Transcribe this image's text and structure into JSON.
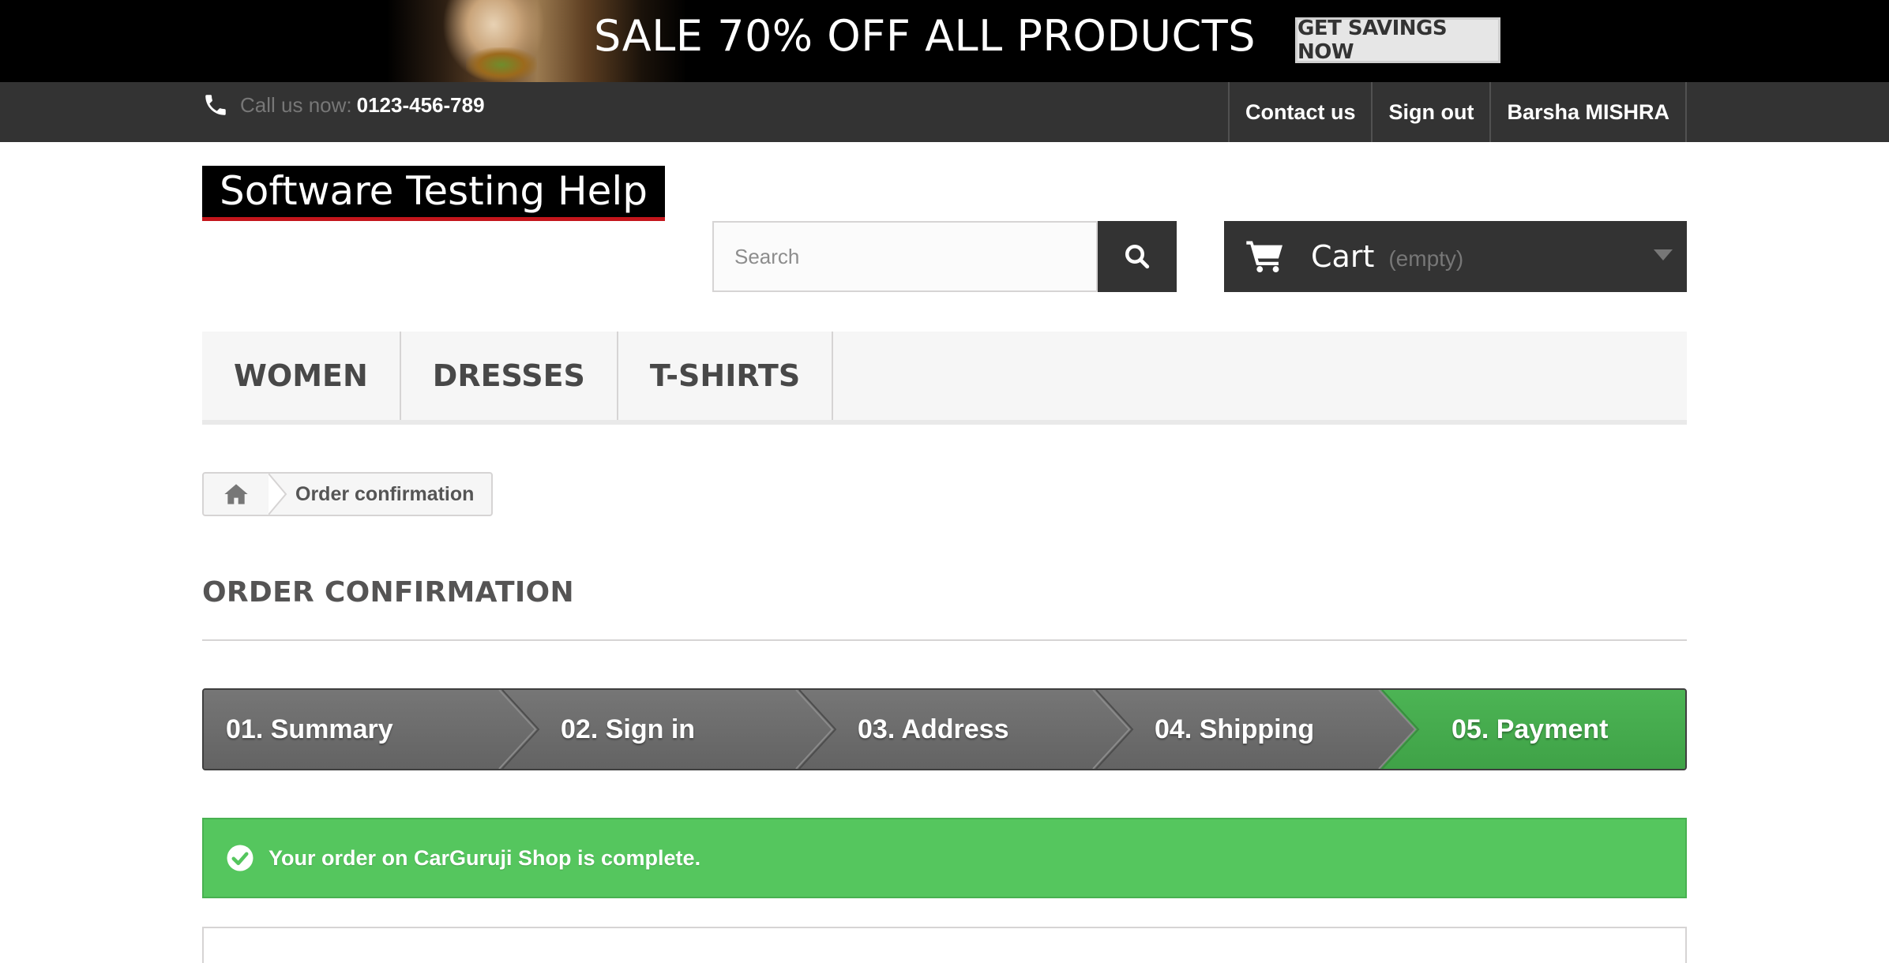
{
  "promo": {
    "text": "SALE 70% OFF ALL PRODUCTS",
    "button_label": "GET SAVINGS NOW"
  },
  "nav": {
    "phone_prefix": "Call us now:",
    "phone_number": "0123-456-789",
    "links": [
      "Contact us",
      "Sign out",
      "Barsha MISHRA"
    ]
  },
  "header": {
    "logo_text": "Software Testing Help",
    "search_placeholder": "Search",
    "cart_label": "Cart",
    "cart_status": "(empty)"
  },
  "menu": {
    "items": [
      "WOMEN",
      "DRESSES",
      "T-SHIRTS"
    ]
  },
  "breadcrumb": {
    "current": "Order confirmation"
  },
  "page": {
    "heading": "ORDER CONFIRMATION"
  },
  "steps": {
    "items": [
      "01. Summary",
      "02. Sign in",
      "03. Address",
      "04. Shipping",
      "05. Payment"
    ],
    "active_index": 4
  },
  "alert": {
    "message": "Your order on CarGuruji Shop is complete."
  },
  "colors": {
    "dark_bar": "#333333",
    "success": "#55c65e",
    "step_active": "#46a94c",
    "step_inactive": "#6f6f6f",
    "brand_red": "#c4161c"
  },
  "icons": {
    "phone": "phone-icon",
    "search": "search-icon",
    "cart": "cart-icon",
    "home": "home-icon",
    "success": "check-circle-icon",
    "dropdown": "chevron-down-icon"
  }
}
